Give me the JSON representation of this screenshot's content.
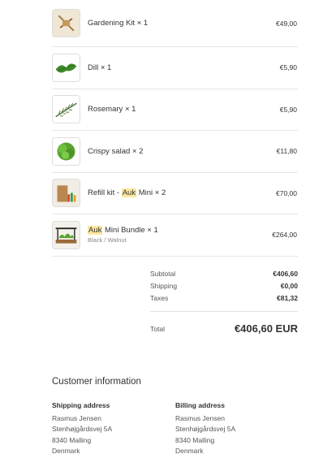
{
  "order_items": [
    {
      "name": "Gardening Kit",
      "qty": "× 1",
      "price": "€49,00",
      "icon": "gardening-kit-thumbnail"
    },
    {
      "name": "Dill",
      "qty": "× 1",
      "price": "€5,90",
      "icon": "dill-thumbnail"
    },
    {
      "name": "Rosemary",
      "qty": "× 1",
      "price": "€5,90",
      "icon": "rosemary-thumbnail"
    },
    {
      "name": "Crispy salad",
      "qty": "× 2",
      "price": "€11,80",
      "icon": "crispy-salad-thumbnail"
    },
    {
      "name_pre": "Refill kit - ",
      "name_hl": "Auk",
      "name_post": " Mini",
      "qty": "× 2",
      "price": "€70,00",
      "icon": "refill-kit-thumbnail"
    },
    {
      "name_hl": "Auk",
      "name_post": " Mini Bundle",
      "qty": "× 1",
      "variant": "Black / Walnut",
      "price": "€264,00",
      "icon": "auk-bundle-thumbnail"
    }
  ],
  "summary": {
    "subtotal_label": "Subtotal",
    "subtotal_value": "€406,60",
    "shipping_label": "Shipping",
    "shipping_value": "€0,00",
    "taxes_label": "Taxes",
    "taxes_value": "€81,32",
    "total_label": "Total",
    "total_value": "€406,60 EUR"
  },
  "customer": {
    "title": "Customer information",
    "shipping": {
      "heading": "Shipping address",
      "lines": [
        "Rasmus Jensen",
        "Stenhøjgårdsvej 5A",
        "8340 Malling",
        "Denmark"
      ]
    },
    "billing": {
      "heading": "Billing address",
      "lines": [
        "Rasmus Jensen",
        "Stenhøjgårdsvej 5A",
        "8340 Malling",
        "Denmark"
      ]
    }
  },
  "colors": {
    "highlight": "#fbe7a1",
    "divider": "#e6e6e6",
    "text": "#333333"
  }
}
